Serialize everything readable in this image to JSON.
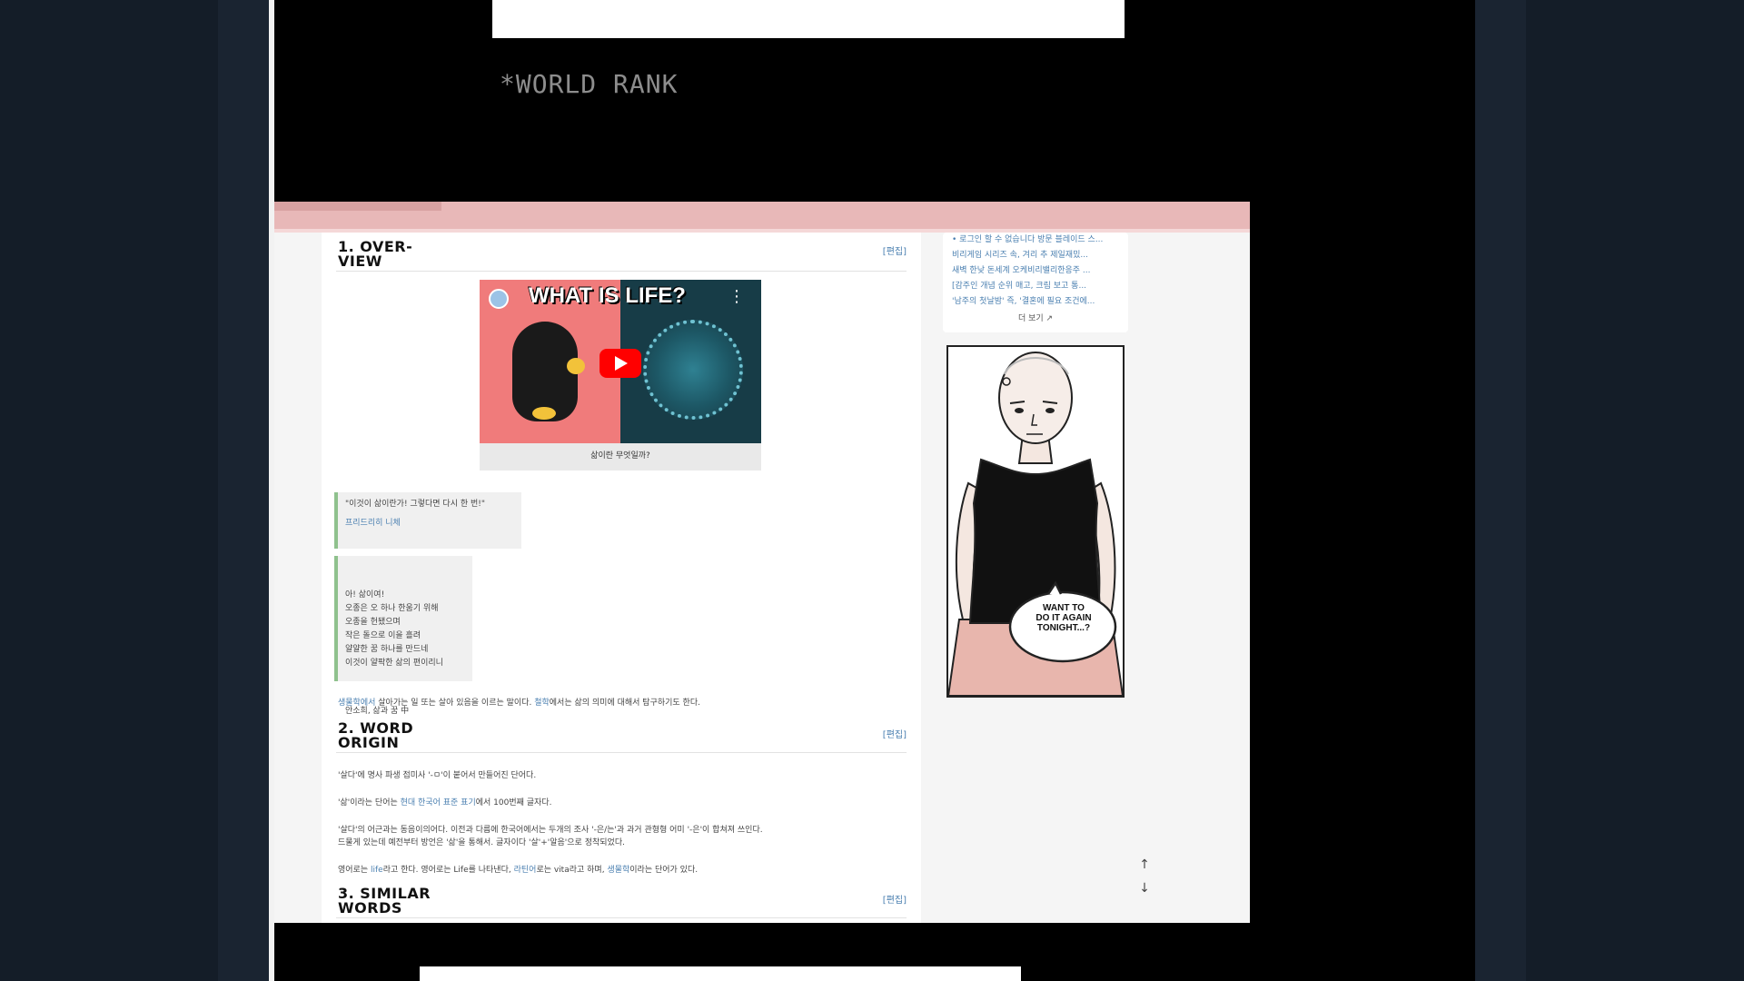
{
  "rank_label": "*WORLD RANK",
  "sections": [
    {
      "label": "1. OVER-\nVIEW",
      "edit": "[편집]"
    },
    {
      "label": "2. WORD\nORIGIN",
      "edit": "[편집]"
    },
    {
      "label": "3. SIMILAR\nWORDS",
      "edit": "[편집]"
    }
  ],
  "video": {
    "title": "WHAT IS LIFE?",
    "caption": "삶이란 무엇일까?",
    "menu": "⋮"
  },
  "quotes": [
    {
      "text": "\"이것이 삶이란가! 그렇다면 다시 한 번!\"",
      "source": "프리드리히 니체"
    },
    {
      "text": "아! 삶이여!\n오종은 오 하나 한움기 위해\n오종을 헌됐으며\n작은 돌으로 이을 흘려\n얄얄한 꿈 하나를 만드네\n이것이 얄팍한 삶의 편이리니",
      "source": "안소희, 삶과 꿈 中"
    }
  ],
  "paragraphs": {
    "p1_parts": [
      {
        "t": "생물학에서 ",
        "link": true
      },
      {
        "t": "살아가는 일 또는 살아 있음을 이르는 말이다. ",
        "link": false
      },
      {
        "t": "철학",
        "link": true
      },
      {
        "t": "에서는 삶의 의미에 대해서 탐구하기도 한다.",
        "link": false
      }
    ],
    "origin_1": "'살다'에 명사 파생 접미사 '-ㅁ'이 붙어서 만들어진 단어다.",
    "origin_2_parts": [
      {
        "t": "'삶'이라는 단어는 ",
        "link": false
      },
      {
        "t": "현대 한국어 표준 표기",
        "link": true
      },
      {
        "t": "에서 100번째 글자다.",
        "link": false
      }
    ],
    "origin_3": "'살다'의 어근과는 동음이의어다. 이전과 다름에 한국어에서는 두개의 조사 '-은/는'과 과거 관형형 어미 '-은'이 합쳐져 쓰인다.",
    "origin_4": "드물게 있는데 예전부터 방언은 '삶'을 통해서. 글자이다 '살'+'알음'으로 정착되었다.",
    "origin_5_parts": [
      {
        "t": "영어로는 ",
        "link": false
      },
      {
        "t": "life",
        "link": true
      },
      {
        "t": "라고 한다. 영어로는 Life를 나타낸다, ",
        "link": false
      },
      {
        "t": "라틴어",
        "link": true
      },
      {
        "t": "로는 vita라고 하며, ",
        "link": false
      },
      {
        "t": "생물학",
        "link": true
      },
      {
        "t": "이라는 단어가 있다.",
        "link": false
      }
    ]
  },
  "sidebar": {
    "lines": [
      "• 로그인 할 수 없습니다 방문 블레이드 스...",
      "비리게임 시리즈 속, 겨리 추 제일재밌...",
      "새벽 한낮 돈세계 오케비리밸리한응주 ...",
      "[감주인 개념 순위 매고, 크림 보고 통...",
      "'남주의 첫날밤' 즉, '결혼에 필요 조건에..."
    ],
    "more": "더 보기 ↗"
  },
  "comic": {
    "speech": "WANT TO\nDO IT AGAIN\nTONIGHT...?"
  },
  "scroll": {
    "up": "↑",
    "down": "↓"
  }
}
